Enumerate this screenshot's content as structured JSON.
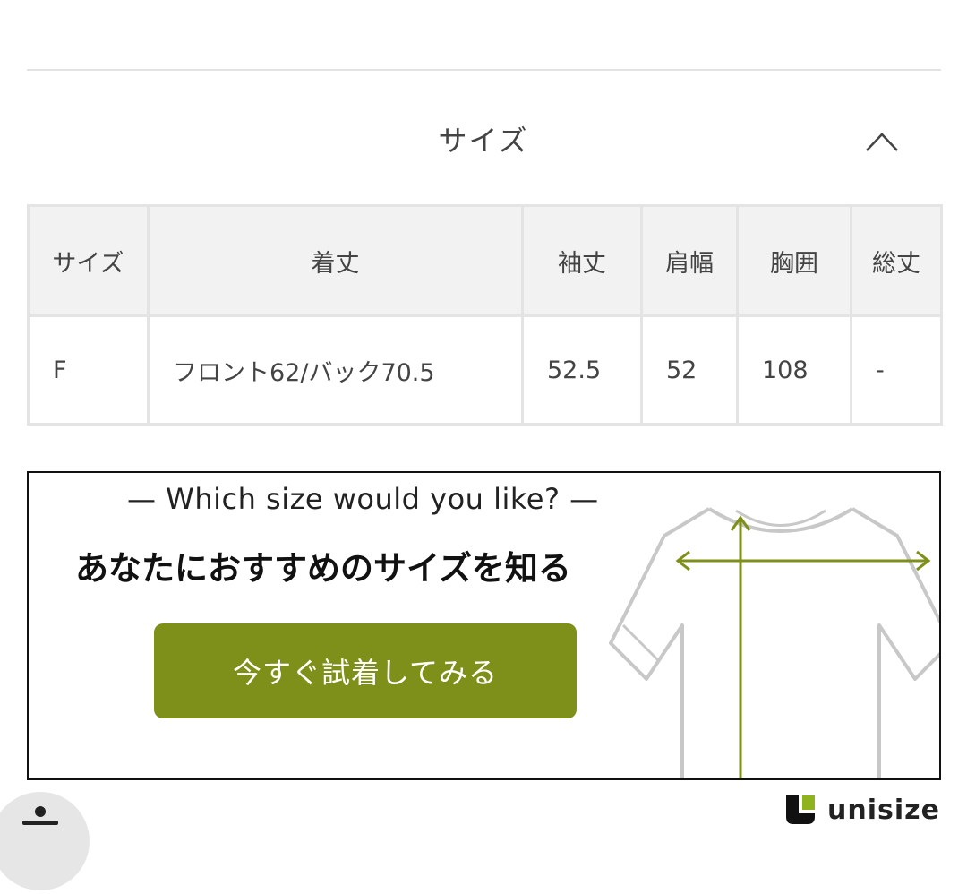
{
  "section": {
    "title": "サイズ"
  },
  "size_table": {
    "headers": [
      "サイズ",
      "着丈",
      "袖丈",
      "肩幅",
      "胸囲",
      "総丈"
    ],
    "rows": [
      [
        "F",
        "フロント62/バック70.5",
        "52.5",
        "52",
        "108",
        "-"
      ]
    ]
  },
  "banner": {
    "subtitle": "— Which size would you like? —",
    "title": "あなたにおすすめのサイズを知る",
    "button_label": "今すぐ試着してみる"
  },
  "brand": {
    "name": "unisize"
  },
  "colors": {
    "accent": "#7f901a",
    "table_header_bg": "#f2f2f2",
    "table_border": "#e4e4e4"
  },
  "icons": [
    "chevron-up-icon",
    "tshirt-illustration",
    "unisize-logo-icon",
    "accessibility-icon"
  ]
}
